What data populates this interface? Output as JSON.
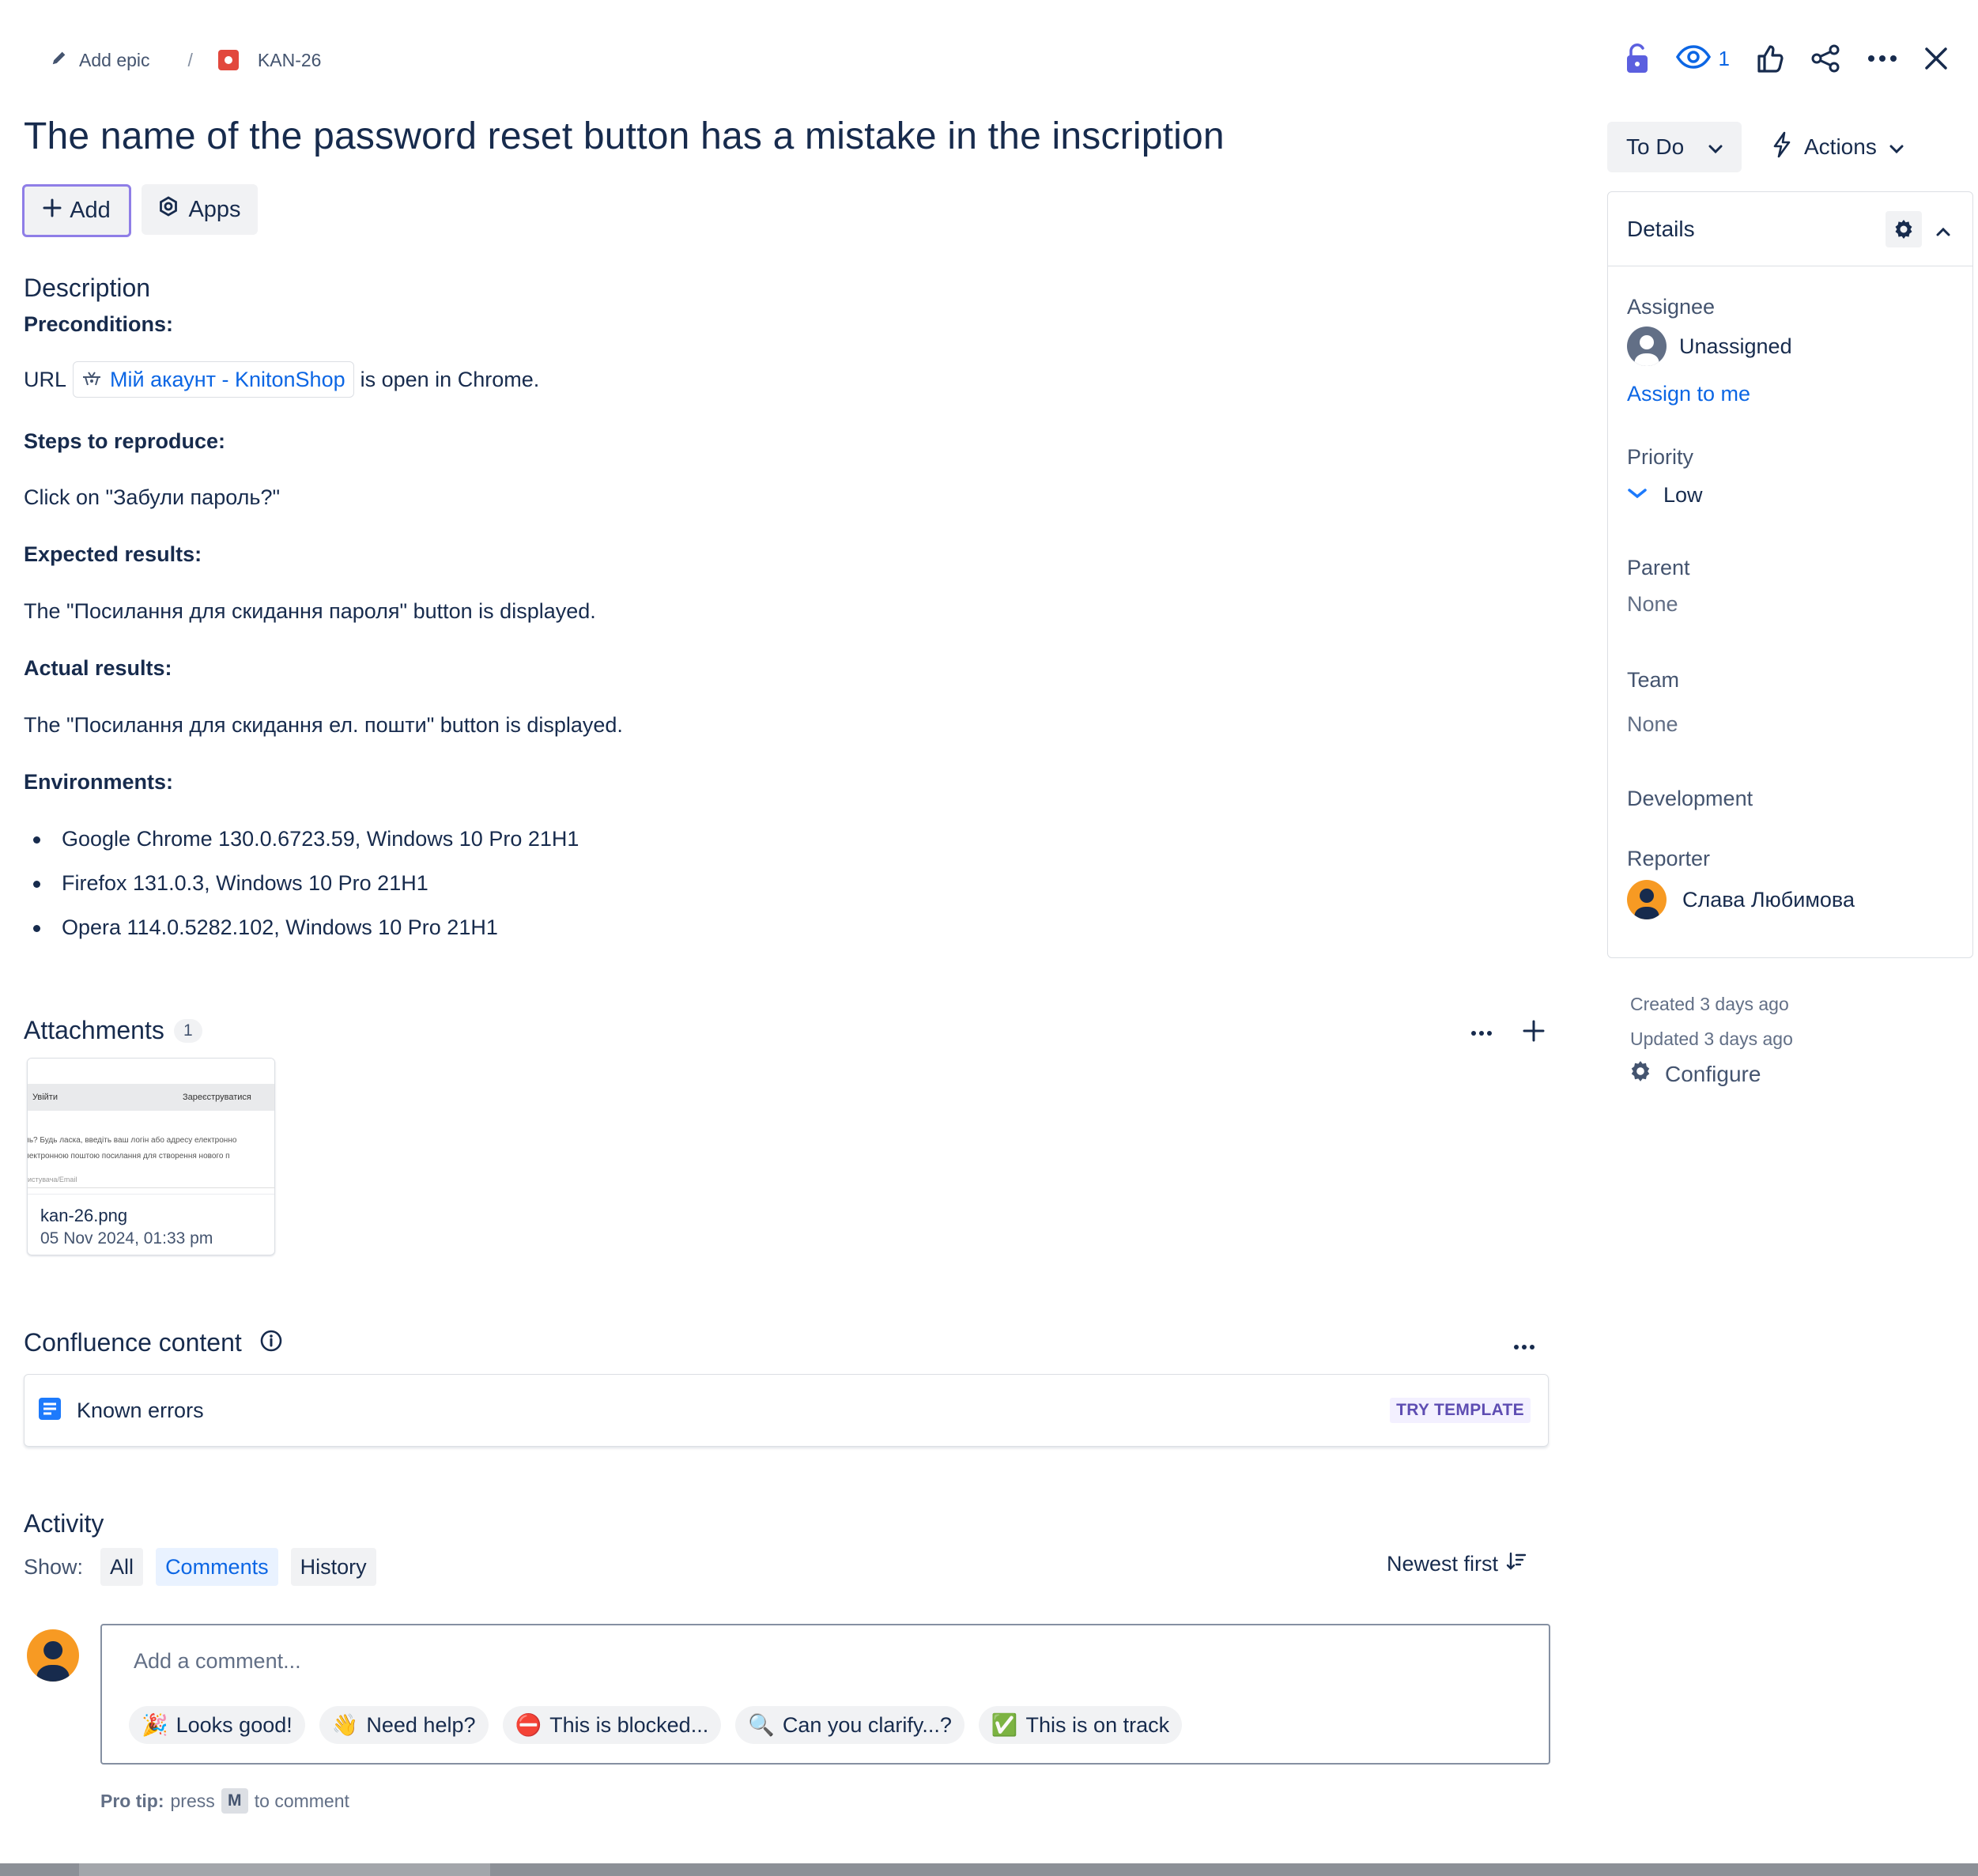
{
  "breadcrumb": {
    "epic_label": "Add epic",
    "separator": "/",
    "issue_key": "KAN-26"
  },
  "header": {
    "watch_count": "1"
  },
  "title": "The name of the password reset button has a mistake in the inscription",
  "toolbar": {
    "add_label": "Add",
    "apps_label": "Apps"
  },
  "description": {
    "heading": "Description",
    "preconditions_label": "Preconditions:",
    "url_prefix": "URL",
    "url_link_text": "Мій акаунт - KnitonShop",
    "url_suffix": "is open in Chrome.",
    "steps_label": "Steps to reproduce:",
    "steps_text": "Click on \"Забули пароль?\"",
    "expected_label": "Expected results:",
    "expected_text": "The \"Посилання для скидання пароля\" button is displayed.",
    "actual_label": "Actual results:",
    "actual_text": "The \"Посилання для скидання ел. пошти\" button is displayed.",
    "environments_label": "Environments:",
    "environments": [
      "Google Chrome 130.0.6723.59, Windows 10 Pro 21H1",
      "Firefox 131.0.3, Windows 10 Pro 21H1",
      "Opera 114.0.5282.102, Windows 10 Pro 21H1"
    ]
  },
  "attachments": {
    "heading": "Attachments",
    "count": "1",
    "thumbnail": {
      "left_tab": "Увійти",
      "right_tab": "Зареєструватися",
      "line1": "ль? Будь ласка, введіть ваш логін або адресу електронно",
      "line2": "лектронною поштою посилання для створення нового п",
      "line3": "истувача/Email"
    },
    "file_name": "kan-26.png",
    "file_date": "05 Nov 2024, 01:33 pm"
  },
  "confluence": {
    "heading": "Confluence content",
    "item_label": "Known errors",
    "try_template_label": "TRY TEMPLATE"
  },
  "activity": {
    "heading": "Activity",
    "show_label": "Show:",
    "filters": [
      "All",
      "Comments",
      "History"
    ],
    "active_filter": "Comments",
    "sort_label": "Newest first",
    "comment_placeholder": "Add a comment...",
    "quick_replies": [
      {
        "emoji": "🎉",
        "label": "Looks good!"
      },
      {
        "emoji": "👋",
        "label": "Need help?"
      },
      {
        "emoji": "⛔",
        "label": "This is blocked..."
      },
      {
        "emoji": "🔍",
        "label": "Can you clarify...?"
      },
      {
        "emoji": "✅",
        "label": "This is on track"
      }
    ],
    "pro_tip_label": "Pro tip:",
    "pro_tip_press": "press",
    "pro_tip_key": "M",
    "pro_tip_suffix": "to comment"
  },
  "sidebar": {
    "status_label": "To Do",
    "actions_label": "Actions",
    "details_heading": "Details",
    "assignee_label": "Assignee",
    "assignee_value": "Unassigned",
    "assign_to_me": "Assign to me",
    "priority_label": "Priority",
    "priority_value": "Low",
    "parent_label": "Parent",
    "parent_value": "None",
    "team_label": "Team",
    "team_value": "None",
    "development_label": "Development",
    "reporter_label": "Reporter",
    "reporter_value": "Слава Любимова",
    "created": "Created 3 days ago",
    "updated": "Updated 3 days ago",
    "configure_label": "Configure"
  },
  "colors": {
    "accent": "#0c66e4",
    "text": "#172b4d",
    "subtle": "#44546f",
    "border": "#dcdfe4",
    "add_focus": "#8f7ee7",
    "avatar": "#f79a23",
    "issue_type": "#e2483d"
  }
}
